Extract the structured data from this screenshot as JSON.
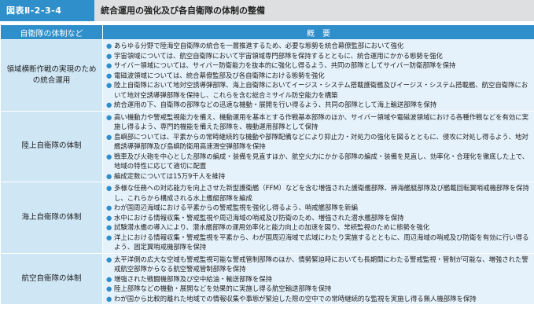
{
  "header": {
    "figure_label": "図表Ⅱ-2-3-4",
    "title": "統合運用の強化及び各自衛隊の体制の整備"
  },
  "table": {
    "columns": [
      "自衛隊の体制など",
      "概　要"
    ],
    "rows": [
      {
        "category": "領域横断作戦の実現のための統合運用",
        "items": [
          "あらゆる分野で陸海空自衛隊の統合を一層推進するため、必要な態勢を統合幕僚監部において強化",
          "宇宙領域については、航空自衛隊において宇宙領域専門部隊を保持するとともに、統合運用にかかる態勢を強化",
          "サイバー領域については、サイバー防衛能力を抜本的に強化し得るよう、共同の部隊としてサイバー防衛部隊を保持",
          "電磁波領域については、統合幕僚監部及び各自衛隊における態勢を強化",
          "陸上自衛隊において地対空誘導弾部隊、海上自衛隊においてイージス・システム搭載護衛艦及びイージス・システム搭載艦、航空自衛隊において地対空誘導弾部隊を保持し、これらを含む総合ミサイル防空能力を構築",
          "統合運用の下、自衛隊の部隊などの迅速な機動・展開を行い得るよう、共同の部隊として海上輸送部隊を保持"
        ]
      },
      {
        "category": "陸上自衛隊の体制",
        "items": [
          "高い機動力や警戒監視能力を備え、機動運用を基本とする作戦基本部隊のほか、サイバー領域や電磁波領域における各種作戦などを有効に実施し得るよう、専門的機能を備えた部隊を、機動運用部隊として保持",
          "島嶼部については、平素からの常時継続的な機動や部隊配備などにより抑止力・対処力の強化を図るとともに、侵攻に対処し得るよう、地対艦誘導弾部隊及び島嶼防衛用高速滑空弾部隊を保持",
          "戦車及び火砲を中心とした部隊の編成・装備を見直すほか、航空火力にかかる部隊の編成・装備を見直し、効率化・合理化を徹底した上で、地域の特性に応じて適切に配置",
          "編成定数については15万9千人を維持"
        ]
      },
      {
        "category": "海上自衛隊の体制",
        "items": [
          "多様な任務への対応能力を向上させた新型護衛艦（FFM）などを含む増強された護衛艦部隊、掃海艦艇部隊及び艦載回転翼哨戒機部隊を保持し、これらから構成される水上艦艇部隊を編成",
          "わが国周辺海域における平素からの警戒監視を強化し得るよう、哨戒艦部隊を新編",
          "水中における情報収集・警戒監視や周辺海域の哨戒及び防衛のため、増強された潜水艦部隊を保持",
          "試験潜水艦の導入により、潜水艦部隊の運用効率化と能力向上の加速を図り、常続監視のために態勢を強化",
          "洋上における情報収集・警戒監視を平素から、わが国周辺海域で広域にわたり実施するとともに、周辺海域の哨戒及び防衛を有効に行い得るよう、固定翼哨戒機部隊を保持"
        ]
      },
      {
        "category": "航空自衛隊の体制",
        "items": [
          "太平洋側の広大な空域も警戒監視可能な警戒管制部隊のほか、情勢緊迫時においても長期間にわたる警戒監視・管制が可能な、増強された警戒航空部隊からなる航空警戒管制部隊を保持",
          "増強された戦闘機部隊及び空中給油・輸送部隊を保持",
          "陸上部隊などの機動・展開などを効果的に実施し得る航空輸送部隊を保持",
          "わが国から比較的離れた地域での情報収集や事態が緊迫した際の空中での常時継続的な監視を実施し得る無人機部隊を保持"
        ]
      }
    ]
  },
  "style": {
    "accent": "#2f8fcb",
    "category_bg": "#cfe6f5",
    "desc_bg": "#e6f2fb",
    "title_bar_bg": "#dedfe0"
  }
}
